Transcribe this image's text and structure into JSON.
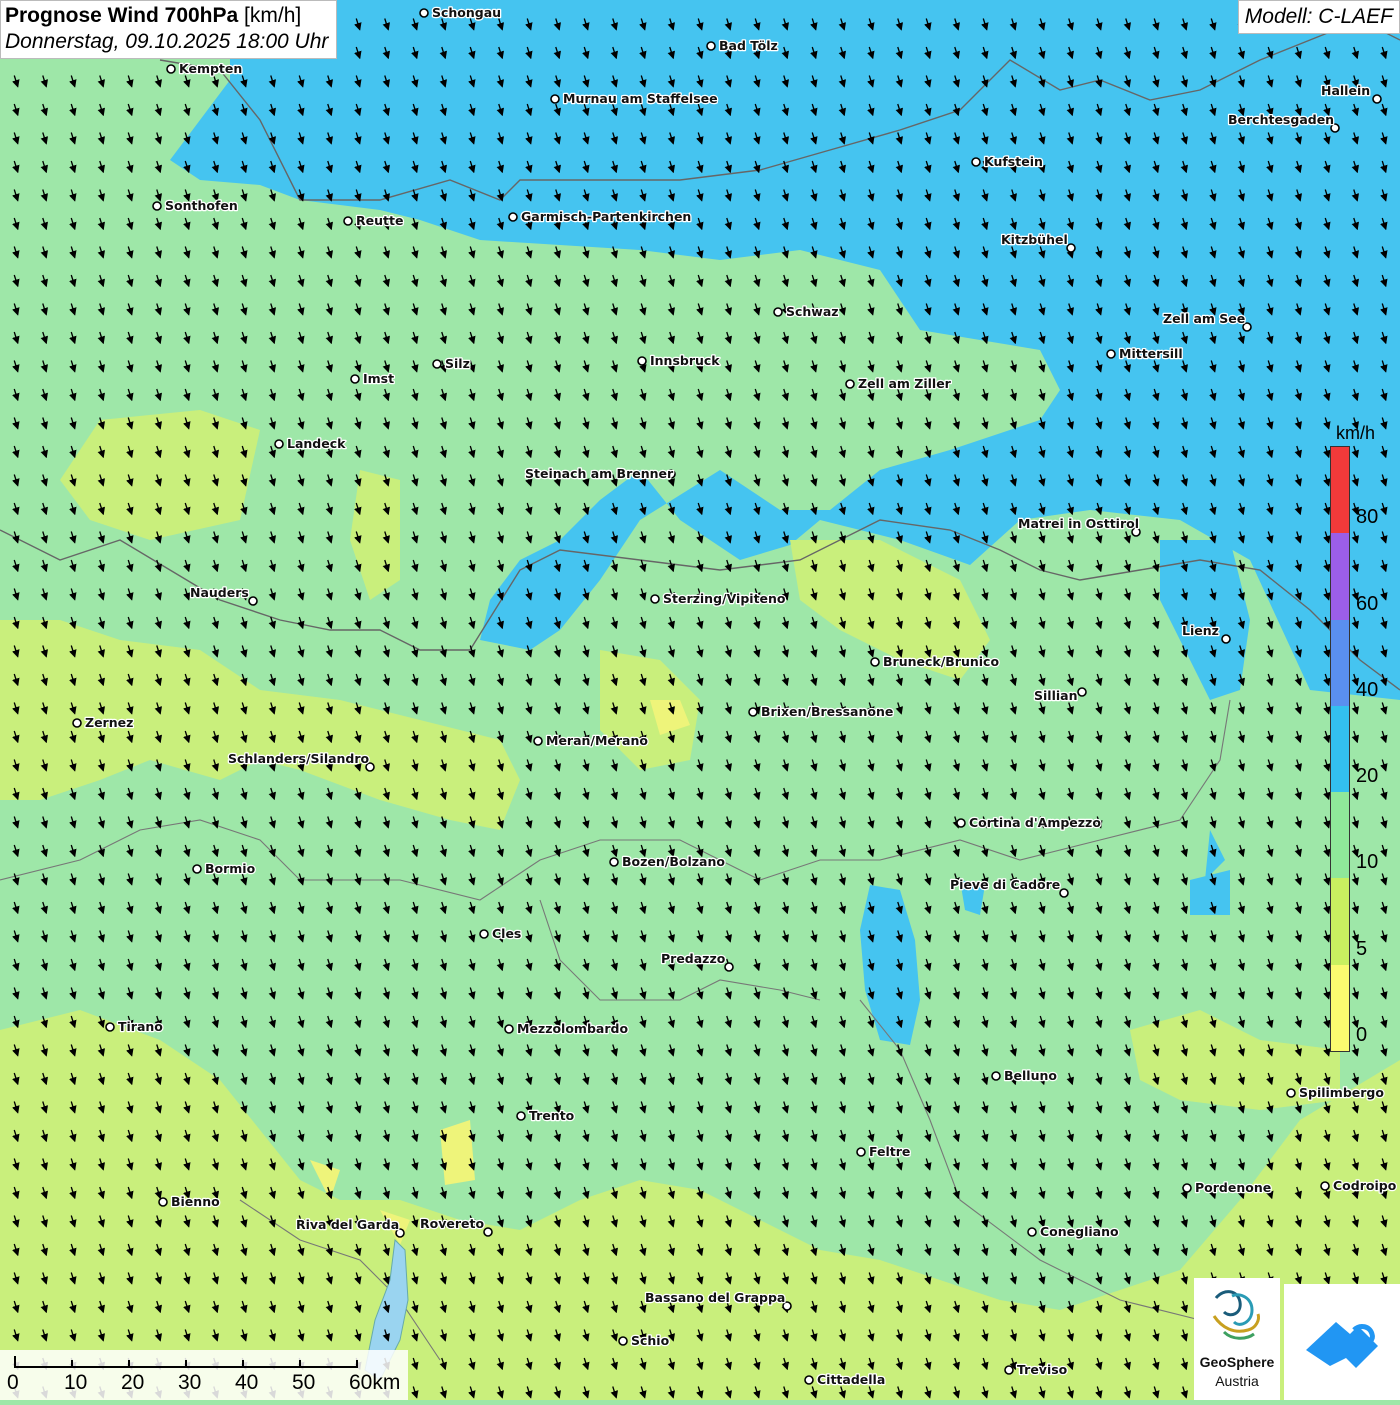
{
  "title": {
    "main": "Prognose Wind 700hPa",
    "unit": "[km/h]",
    "subtitle": "Donnerstag, 09.10.2025 18:00 Uhr"
  },
  "model": "Modell: C-LAEF",
  "legend": {
    "unit": "km/h",
    "ticks": [
      "80",
      "60",
      "40",
      "20",
      "10",
      "5",
      "0"
    ],
    "colors": [
      "#f23a3a",
      "#9b5ee8",
      "#5a8ff0",
      "#33c0f0",
      "#8fe89a",
      "#c8f060",
      "#fafa70"
    ]
  },
  "scale": {
    "ticks": [
      "0",
      "10",
      "20",
      "30",
      "40",
      "50",
      "60km"
    ]
  },
  "field_colors": {
    "strong": "#45c4f0",
    "medium": "#9ee7a8",
    "weak": "#c9ef7c",
    "calm": "#eef47a"
  },
  "wind_arrow_direction": "south-southeast",
  "cities": [
    "Schongau",
    "Bad Tölz",
    "Kempten",
    "Murnau am Staffelsee",
    "Hallein",
    "Berchtesgaden",
    "Kufstein",
    "Sonthofen",
    "Reutte",
    "Garmisch-Partenkirchen",
    "Kitzbühel",
    "Schwaz",
    "Zell am See",
    "Mittersill",
    "Innsbruck",
    "Silz",
    "Imst",
    "Zell am Ziller",
    "Landeck",
    "Steinach am Brenner",
    "Matrei in Osttirol",
    "Nauders",
    "Sterzing/Vipiteno",
    "Lienz",
    "Bruneck/Brunico",
    "Sillian",
    "Brixen/Bressanone",
    "Zernez",
    "Meran/Merano",
    "Schlanders/Silandro",
    "Cortina d'Ampezzo",
    "Bozen/Bolzano",
    "Bormio",
    "Pieve di Cadore",
    "Cles",
    "Predazzo",
    "Tirano",
    "Mezzolombardo",
    "Belluno",
    "Spilimbergo",
    "Trento",
    "Feltre",
    "Pordenone",
    "Codroipo",
    "Bienno",
    "Riva del Garda",
    "Rovereto",
    "Conegliano",
    "Bassano del Grappa",
    "Schio",
    "Treviso",
    "Cittadella"
  ],
  "logo": {
    "name": "GeoSphere",
    "sub": "Austria"
  }
}
